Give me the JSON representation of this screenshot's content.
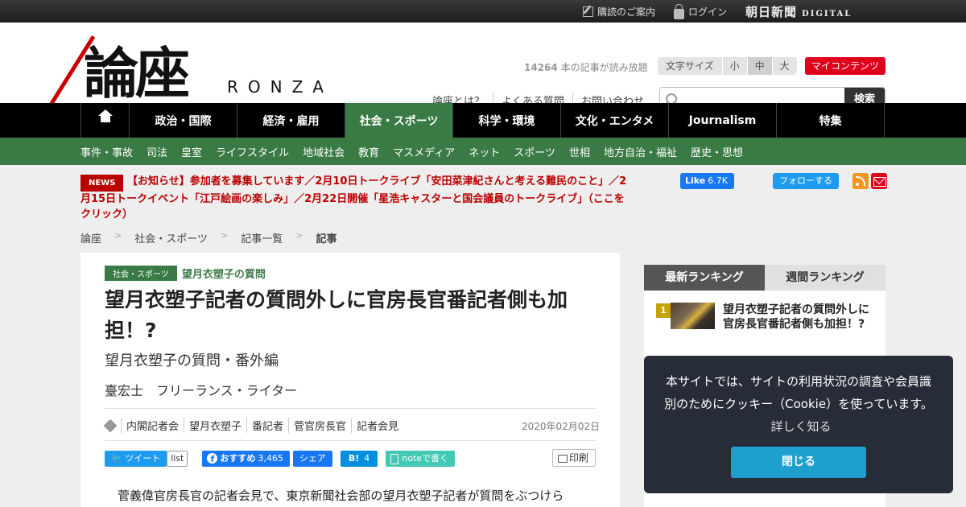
{
  "topbar": {
    "subscribe": "購読のご案内",
    "login": "ログイン",
    "asahi": "朝日新聞",
    "digital": "DIGITAL"
  },
  "header": {
    "logo_kanji": "論座",
    "logo_roman": "RONZA",
    "read_count": "14264",
    "read_count_suffix": "本の記事が読み放題",
    "font_size_label": "文字サイズ",
    "font_small": "小",
    "font_medium": "中",
    "font_large": "大",
    "my_contents": "マイコンテンツ",
    "links": [
      "論座とは？",
      "よくある質問",
      "お問い合わせ"
    ],
    "search_placeholder": "",
    "search_button": "検索"
  },
  "mainnav": {
    "items": [
      "政治・国際",
      "経済・雇用",
      "社会・スポーツ",
      "科学・環境",
      "文化・エンタメ",
      "Journalism",
      "特集"
    ],
    "active": "社会・スポーツ"
  },
  "subnav": {
    "items": [
      "事件・事故",
      "司法",
      "皇室",
      "ライフスタイル",
      "地域社会",
      "教育",
      "マスメディア",
      "ネット",
      "スポーツ",
      "世相",
      "地方自治・福祉",
      "歴史・思想"
    ]
  },
  "news": {
    "badge": "NEWS",
    "text": "【お知らせ】参加者を募集しています／2月10日トークライブ「安田菜津紀さんと考える難民のこと」／2月15日トークイベント「江戸絵画の楽しみ」／2月22日開催「星浩キャスターと国会議員のトークライブ」（ここをクリック）"
  },
  "social": {
    "fb_like": "Like",
    "fb_count": "6.7K",
    "tw_follow": "フォローする"
  },
  "breadcrumb": [
    "論座",
    "社会・スポーツ",
    "記事一覧",
    "記事"
  ],
  "breadcrumb_sep": ">",
  "article": {
    "category": "社会・スポーツ",
    "series": "望月衣塑子の質問",
    "title": "望月衣塑子記者の質問外しに官房長官番記者側も加担！?",
    "subtitle": "望月衣塑子の質問・番外編",
    "author": "臺宏士　フリーランス・ライター",
    "tags": [
      "内閣記者会",
      "望月衣塑子",
      "番記者",
      "菅官房長官",
      "記者会見"
    ],
    "date": "2020年02月02日",
    "share": {
      "tweet": "ツイート",
      "list": "list",
      "fb_recommend": "おすすめ",
      "fb_count": "3,465",
      "fb_share": "シェア",
      "hatena": "B!",
      "hatena_count": "4",
      "note": "noteで書く",
      "print": "印刷"
    },
    "body_first": "菅義偉官房長官の記者会見で、東京新聞社会部の望月衣塑子記者が質問をぶつけら"
  },
  "ranking": {
    "tab_latest": "最新ランキング",
    "tab_weekly": "週間ランキング",
    "items": [
      {
        "rank": "1",
        "title": "望月衣塑子記者の質問外しに官房長官番記者側も加担！?"
      }
    ]
  },
  "cookie": {
    "text": "本サイトでは、サイトの利用状況の調査や会員識別のためにクッキー（Cookie）を使っています。",
    "more": "詳しく知る",
    "close": "閉じる"
  }
}
